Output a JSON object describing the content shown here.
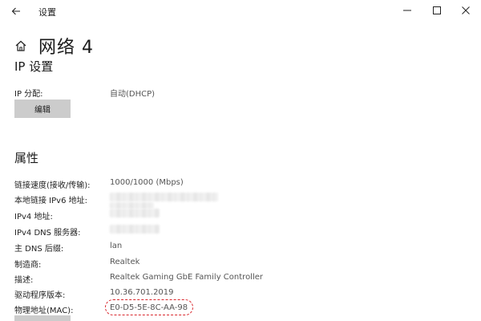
{
  "window": {
    "title": "设置",
    "icons": {
      "back": "arrow-left-icon",
      "minimize": "minimize-icon",
      "maximize": "maximize-icon",
      "close": "close-icon",
      "home": "home-icon"
    }
  },
  "page": {
    "title": "网络 4"
  },
  "ip_settings": {
    "heading": "IP 设置",
    "assignment_label": "IP 分配:",
    "assignment_value": "自动(DHCP)",
    "edit_button": "编辑"
  },
  "properties": {
    "heading": "属性",
    "rows": [
      {
        "label": "链接速度(接收/传输):",
        "value": "1000/1000 (Mbps)"
      },
      {
        "label": "本地链接 IPv6 地址:",
        "value": ""
      },
      {
        "label": "IPv4 地址:",
        "value": ""
      },
      {
        "label": "IPv4 DNS 服务器:",
        "value": ""
      },
      {
        "label": "主 DNS 后缀:",
        "value": "lan"
      },
      {
        "label": "制造商:",
        "value": "Realtek"
      },
      {
        "label": "描述:",
        "value": "Realtek Gaming GbE Family Controller"
      },
      {
        "label": "驱动程序版本:",
        "value": "10.36.701.2019"
      },
      {
        "label": "物理地址(MAC):",
        "value": "E0-D5-5E-8C-AA-98"
      }
    ]
  },
  "colors": {
    "highlight": "#d9262c",
    "button_bg": "#cccccc"
  }
}
